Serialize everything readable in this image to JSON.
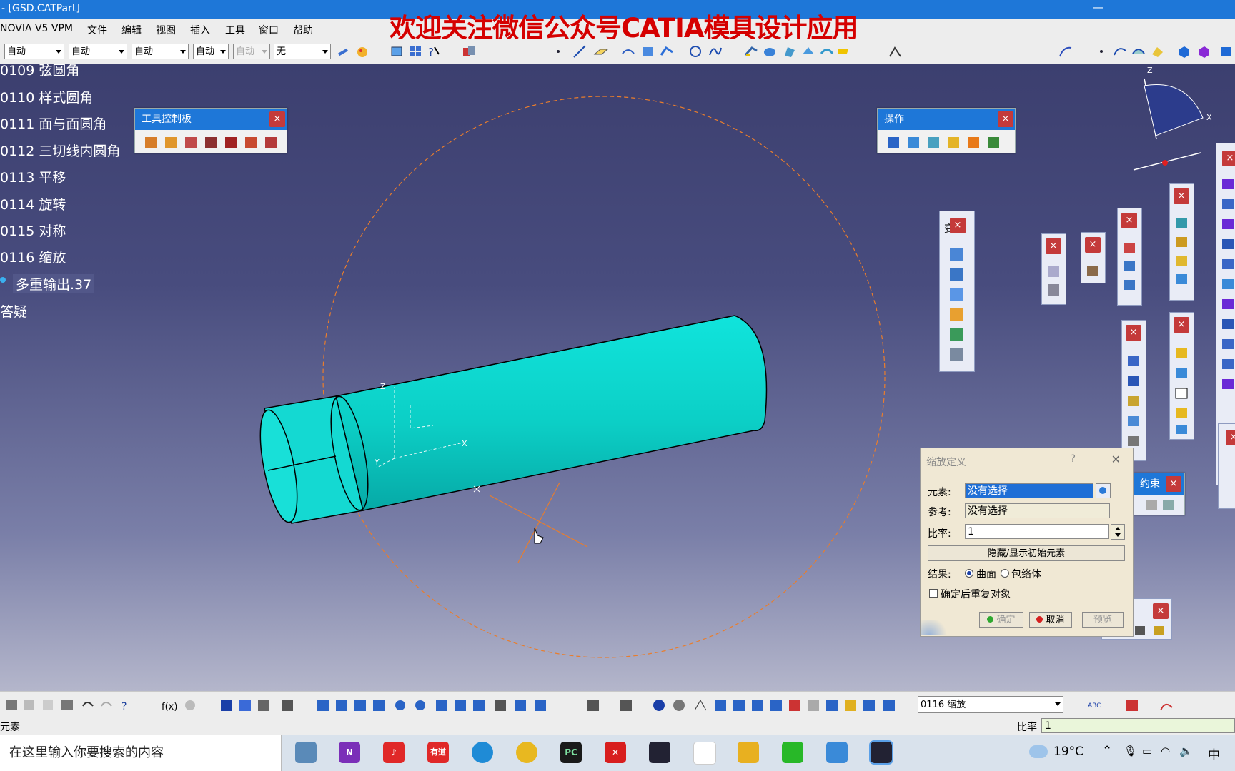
{
  "window": {
    "title": "- [GSD.CATPart]",
    "minimize_glyph": "—"
  },
  "watermark": "欢迎关注微信公众号CATIA模具设计应用",
  "menu": [
    "NOVIA V5 VPM",
    "文件",
    "编辑",
    "视图",
    "插入",
    "工具",
    "窗口",
    "帮助"
  ],
  "toolbar_combos": [
    {
      "value": "自动",
      "enabled": true
    },
    {
      "value": "自动",
      "enabled": true
    },
    {
      "value": "自动",
      "enabled": true
    },
    {
      "value": "自动",
      "enabled": true
    },
    {
      "value": "自动",
      "enabled": false
    },
    {
      "value": "无",
      "enabled": true
    }
  ],
  "tree": [
    {
      "label": "0109 弦圆角"
    },
    {
      "label": "0110 样式圆角"
    },
    {
      "label": "0111 面与面圆角"
    },
    {
      "label": "0112 三切线内圆角"
    },
    {
      "label": "0113 平移"
    },
    {
      "label": "0114 旋转"
    },
    {
      "label": "0115 对称"
    },
    {
      "label": "0116 缩放"
    },
    {
      "label": "多重输出.37"
    },
    {
      "label": "答疑"
    }
  ],
  "palettes": {
    "tools": {
      "title": "工具控制板",
      "close": "×"
    },
    "operations": {
      "title": "操作",
      "close": "×"
    },
    "transform": {
      "title": "变",
      "close": "×"
    },
    "constraints": {
      "title": "约束",
      "close": "×"
    }
  },
  "axis_labels": {
    "z": "Z",
    "x": "X",
    "y": "Y"
  },
  "dialog": {
    "title": "缩放定义",
    "help": "?",
    "close": "✕",
    "element_label": "元素:",
    "element_value": "没有选择",
    "reference_label": "参考:",
    "reference_value": "没有选择",
    "ratio_label": "比率:",
    "ratio_value": "1",
    "toggle_button": "隐藏/显示初始元素",
    "result_label": "结果:",
    "result_options": [
      "曲面",
      "包络体"
    ],
    "result_selected": "曲面",
    "repeat_label": "确定后重复对象",
    "repeat_checked": false,
    "ok": "确定",
    "cancel": "取消",
    "preview": "预览"
  },
  "bottom_toolbar": {
    "current_selection": "0116 缩放"
  },
  "status": {
    "left": "元素",
    "ratio_label": "比率",
    "ratio_value": "1"
  },
  "taskbar": {
    "search_placeholder": "在这里输入你要搜索的内容",
    "weather": "19°C",
    "ime": "中"
  },
  "colors": {
    "title_blue": "#1e77d8",
    "cylinder": "#17d7cf",
    "watermark": "#d50000",
    "dialog_bg": "#f0e8d4"
  }
}
